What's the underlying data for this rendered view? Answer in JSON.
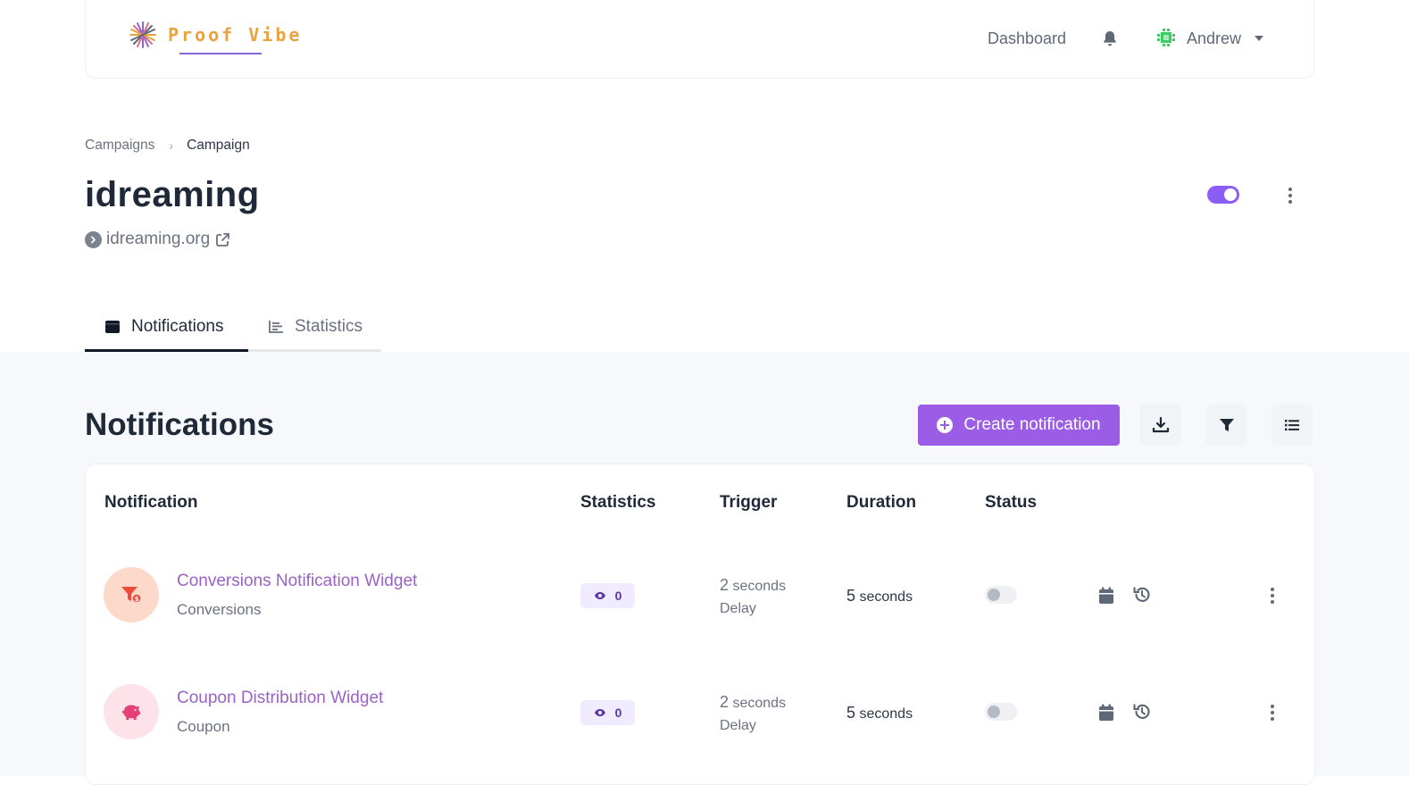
{
  "header": {
    "brand": "Proof Vibe",
    "nav_dashboard": "Dashboard",
    "user_name": "Andrew"
  },
  "breadcrumb": {
    "parent": "Campaigns",
    "current": "Campaign"
  },
  "campaign": {
    "title": "idreaming",
    "site": "idreaming.org",
    "enabled": true
  },
  "tabs": [
    {
      "label": "Notifications",
      "active": true
    },
    {
      "label": "Statistics",
      "active": false
    }
  ],
  "section": {
    "title": "Notifications",
    "create_label": "Create notification"
  },
  "table": {
    "columns": [
      "Notification",
      "Statistics",
      "Trigger",
      "Duration",
      "Status"
    ],
    "rows": [
      {
        "name": "Conversions Notification Widget",
        "type": "Conversions",
        "views": "0",
        "trigger_value": "2",
        "trigger_unit": "seconds",
        "trigger_label": "Delay",
        "duration_value": "5",
        "duration_unit": "seconds",
        "enabled": false,
        "icon": "funnel-dollar-icon"
      },
      {
        "name": "Coupon Distribution Widget",
        "type": "Coupon",
        "views": "0",
        "trigger_value": "2",
        "trigger_unit": "seconds",
        "trigger_label": "Delay",
        "duration_value": "5",
        "duration_unit": "seconds",
        "enabled": false,
        "icon": "piggy-bank-icon"
      }
    ]
  },
  "colors": {
    "accent": "#9b5de5",
    "brand_text": "#e8a23f",
    "link": "#9b62c5",
    "conversions_icon_bg": "#fdd9cc",
    "coupon_icon_bg": "#fde2ea"
  }
}
